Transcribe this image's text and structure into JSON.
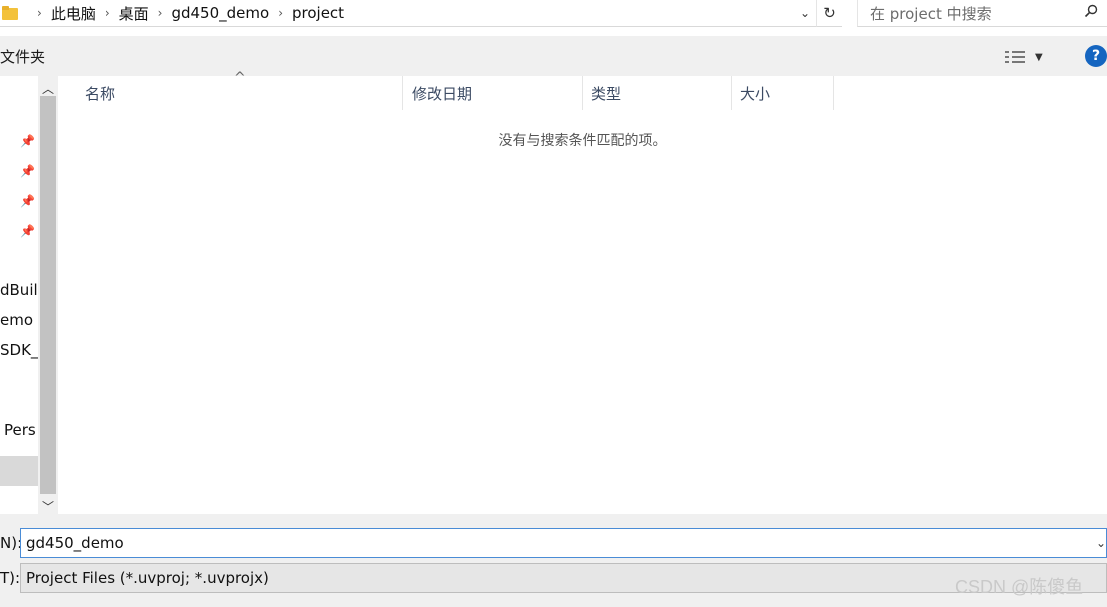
{
  "address": {
    "breadcrumbs": [
      "此电脑",
      "桌面",
      "gd450_demo",
      "project"
    ],
    "search_placeholder": "在 project 中搜索"
  },
  "toolbar": {
    "new_folder_label": "文件夹"
  },
  "nav": {
    "items": [
      "dBuil",
      "emo",
      "SDK_",
      "Pers"
    ]
  },
  "file_list": {
    "columns": [
      "名称",
      "修改日期",
      "类型",
      "大小"
    ],
    "empty_message": "没有与搜索条件匹配的项。"
  },
  "bottom": {
    "filename_label": "N):",
    "filename_value": "gd450_demo",
    "filetype_label": "T):",
    "filetype_value": "Project Files (*.uvproj; *.uvprojx)"
  },
  "watermark": "CSDN @陈傻鱼"
}
